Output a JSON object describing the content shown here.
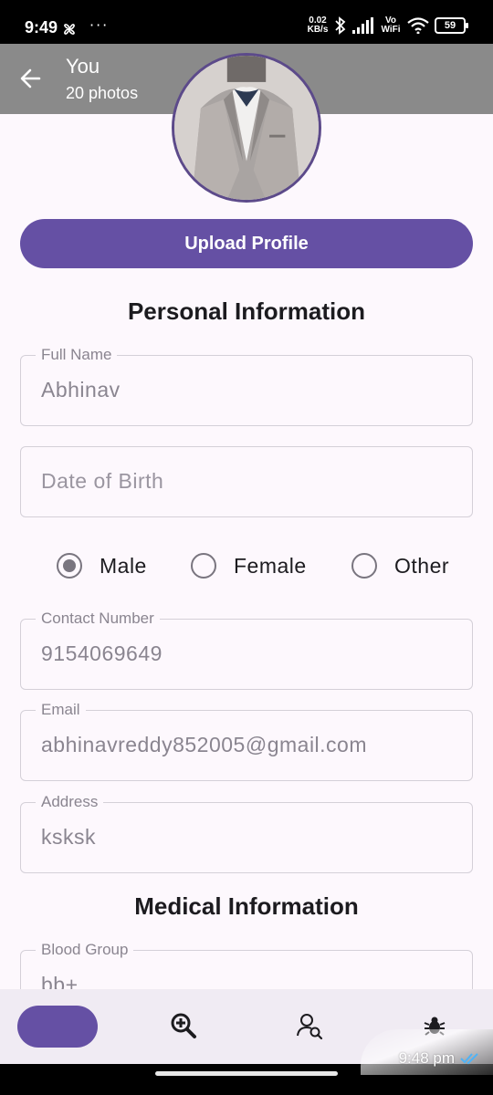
{
  "status_bar": {
    "time": "9:49",
    "more": "···",
    "speed": "0.02\nKB/s",
    "network": "Vo\nWiFi",
    "battery": "59"
  },
  "viewer": {
    "title": "You",
    "subtitle": "20 photos"
  },
  "profile": {
    "upload_label": "Upload Profile"
  },
  "personal": {
    "title": "Personal Information",
    "full_name": {
      "label": "Full Name",
      "value": "Abhinav"
    },
    "dob": {
      "placeholder": "Date of Birth"
    },
    "gender": {
      "options": [
        "Male",
        "Female",
        "Other"
      ],
      "selected": "Male"
    },
    "contact": {
      "label": "Contact Number",
      "value": "9154069649"
    },
    "email": {
      "label": "Email",
      "value": "abhinavreddy852005@gmail.com"
    },
    "address": {
      "label": "Address",
      "value": "ksksk"
    }
  },
  "medical": {
    "title": "Medical Information",
    "blood_group": {
      "label": "Blood Group",
      "value": "bb+"
    }
  },
  "overlay": {
    "timestamp": "9:48 pm"
  },
  "colors": {
    "primary": "#6550a4",
    "surface": "#fdf8fd",
    "nav_bg": "#f0ebf3"
  },
  "icons": {
    "nav": [
      "home-pill",
      "zoom-add-icon",
      "user-search-icon",
      "bug-icon"
    ]
  }
}
